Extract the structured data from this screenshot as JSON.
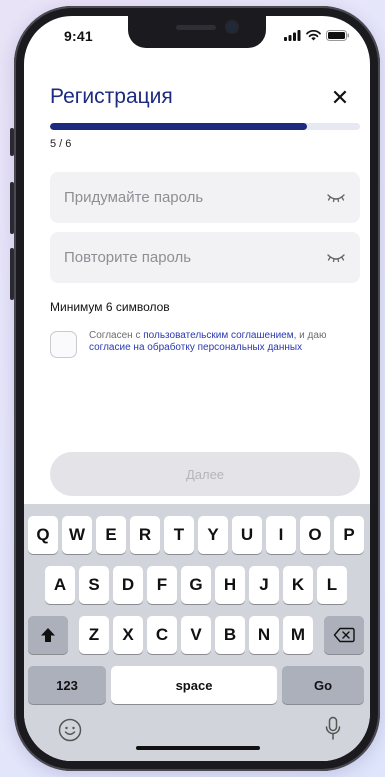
{
  "status_bar": {
    "time": "9:41"
  },
  "header": {
    "title": "Регистрация",
    "close_symbol": "✕"
  },
  "progress": {
    "current": 5,
    "total": 6,
    "label": "5 / 6",
    "fraction": 0.83
  },
  "fields": {
    "password": {
      "placeholder": "Придумайте пароль",
      "value": ""
    },
    "repeat": {
      "placeholder": "Повторите пароль",
      "value": ""
    }
  },
  "hint": "Минимум 6 символов",
  "consent": {
    "checked": false,
    "text_1": "Согласен с ",
    "link_1": "пользовательским соглашением",
    "text_2": ", и даю ",
    "link_2": "согласие на обработку персональных данных"
  },
  "next_button": {
    "label": "Далее",
    "enabled": false
  },
  "keyboard": {
    "row1": [
      "Q",
      "W",
      "E",
      "R",
      "T",
      "Y",
      "U",
      "I",
      "O",
      "P"
    ],
    "row2": [
      "A",
      "S",
      "D",
      "F",
      "G",
      "H",
      "J",
      "K",
      "L"
    ],
    "row3": [
      "Z",
      "X",
      "C",
      "V",
      "B",
      "N",
      "M"
    ],
    "numbers": "123",
    "space": "space",
    "go": "Go",
    "icons": [
      "shift-icon",
      "backspace-icon",
      "emoji-icon",
      "microphone-icon"
    ]
  },
  "colors": {
    "accent": "#1c2b80",
    "link": "#2a39b0",
    "field_bg": "#f2f2f5",
    "disabled_bg": "#e4e4e8"
  }
}
